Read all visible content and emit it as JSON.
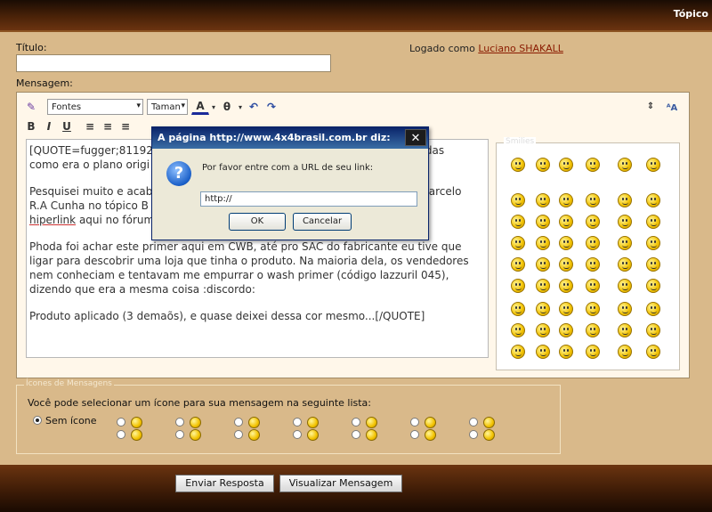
{
  "header": {
    "title": "Tópico"
  },
  "form": {
    "titulo_label": "Título:",
    "titulo_value": "",
    "logged_prefix": "Logado como",
    "logged_user": "Luciano SHAKALL",
    "mensagem_label": "Mensagem:"
  },
  "toolbar": {
    "font_select": "Fontes",
    "size_select": "Taman",
    "bold": "B",
    "italic": "I",
    "underline": "U"
  },
  "message": {
    "p1a": "[QUOTE=fugger;81192",
    "p1b": "das",
    "p1c": "como era o plano origi",
    "p2a": "Pesquisei muito e acab",
    "p2b": "Marcelo",
    "p2c": "R.A Cunha no tópico B",
    "p2d": "o",
    "p2e": "hiperlink",
    "p2f": "aqui no fórum",
    "p3": "Phoda foi achar este primer aqui em CWB, até pro SAC do fabricante eu tive que ligar para descobrir uma loja que tinha o produto. Na maioria dela, os vendedores nem conheciam e tentavam me empurrar o wash primer (código lazzuril 045), dizendo que era a mesma coisa :discordo:",
    "p4": "Produto aplicado (3 demaõs), e quase deixei dessa cor mesmo...[/QUOTE]"
  },
  "smilies": {
    "legend": "Smilies"
  },
  "dialog": {
    "title": "A página http://www.4x4brasil.com.br diz:",
    "close": "✕",
    "icon": "?",
    "message": "Por favor entre com a URL de seu link:",
    "input_value": "http://",
    "ok": "OK",
    "cancel": "Cancelar"
  },
  "icons_section": {
    "legend": "Ícones de Mensagens",
    "instruction": "Você pode selecionar um ícone para sua mensagem na seguinte lista:",
    "no_icon_label": "Sem ícone"
  },
  "buttons": {
    "submit": "Enviar Resposta",
    "preview": "Visualizar Mensagem"
  }
}
